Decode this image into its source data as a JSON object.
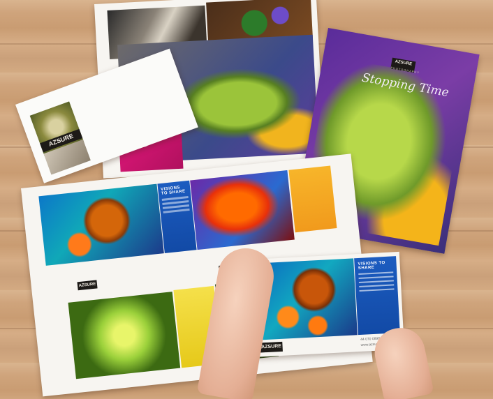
{
  "brand": {
    "logo_text": "AZSURE",
    "logo_subtext": "PHOTOGRAPHY"
  },
  "brochure": {
    "title": "Stopping Time"
  },
  "spread": {
    "heading": "VISIONS TO SHARE",
    "phone": "44 070 0898 2614",
    "web": "www.azsurephotos.com"
  },
  "colors": {
    "wood": "#d2a983",
    "brand_blue": "#1a56b8",
    "accent_yellow": "#f2c21a",
    "accent_orange": "#f5a623",
    "purple": "#6a3aa8"
  }
}
